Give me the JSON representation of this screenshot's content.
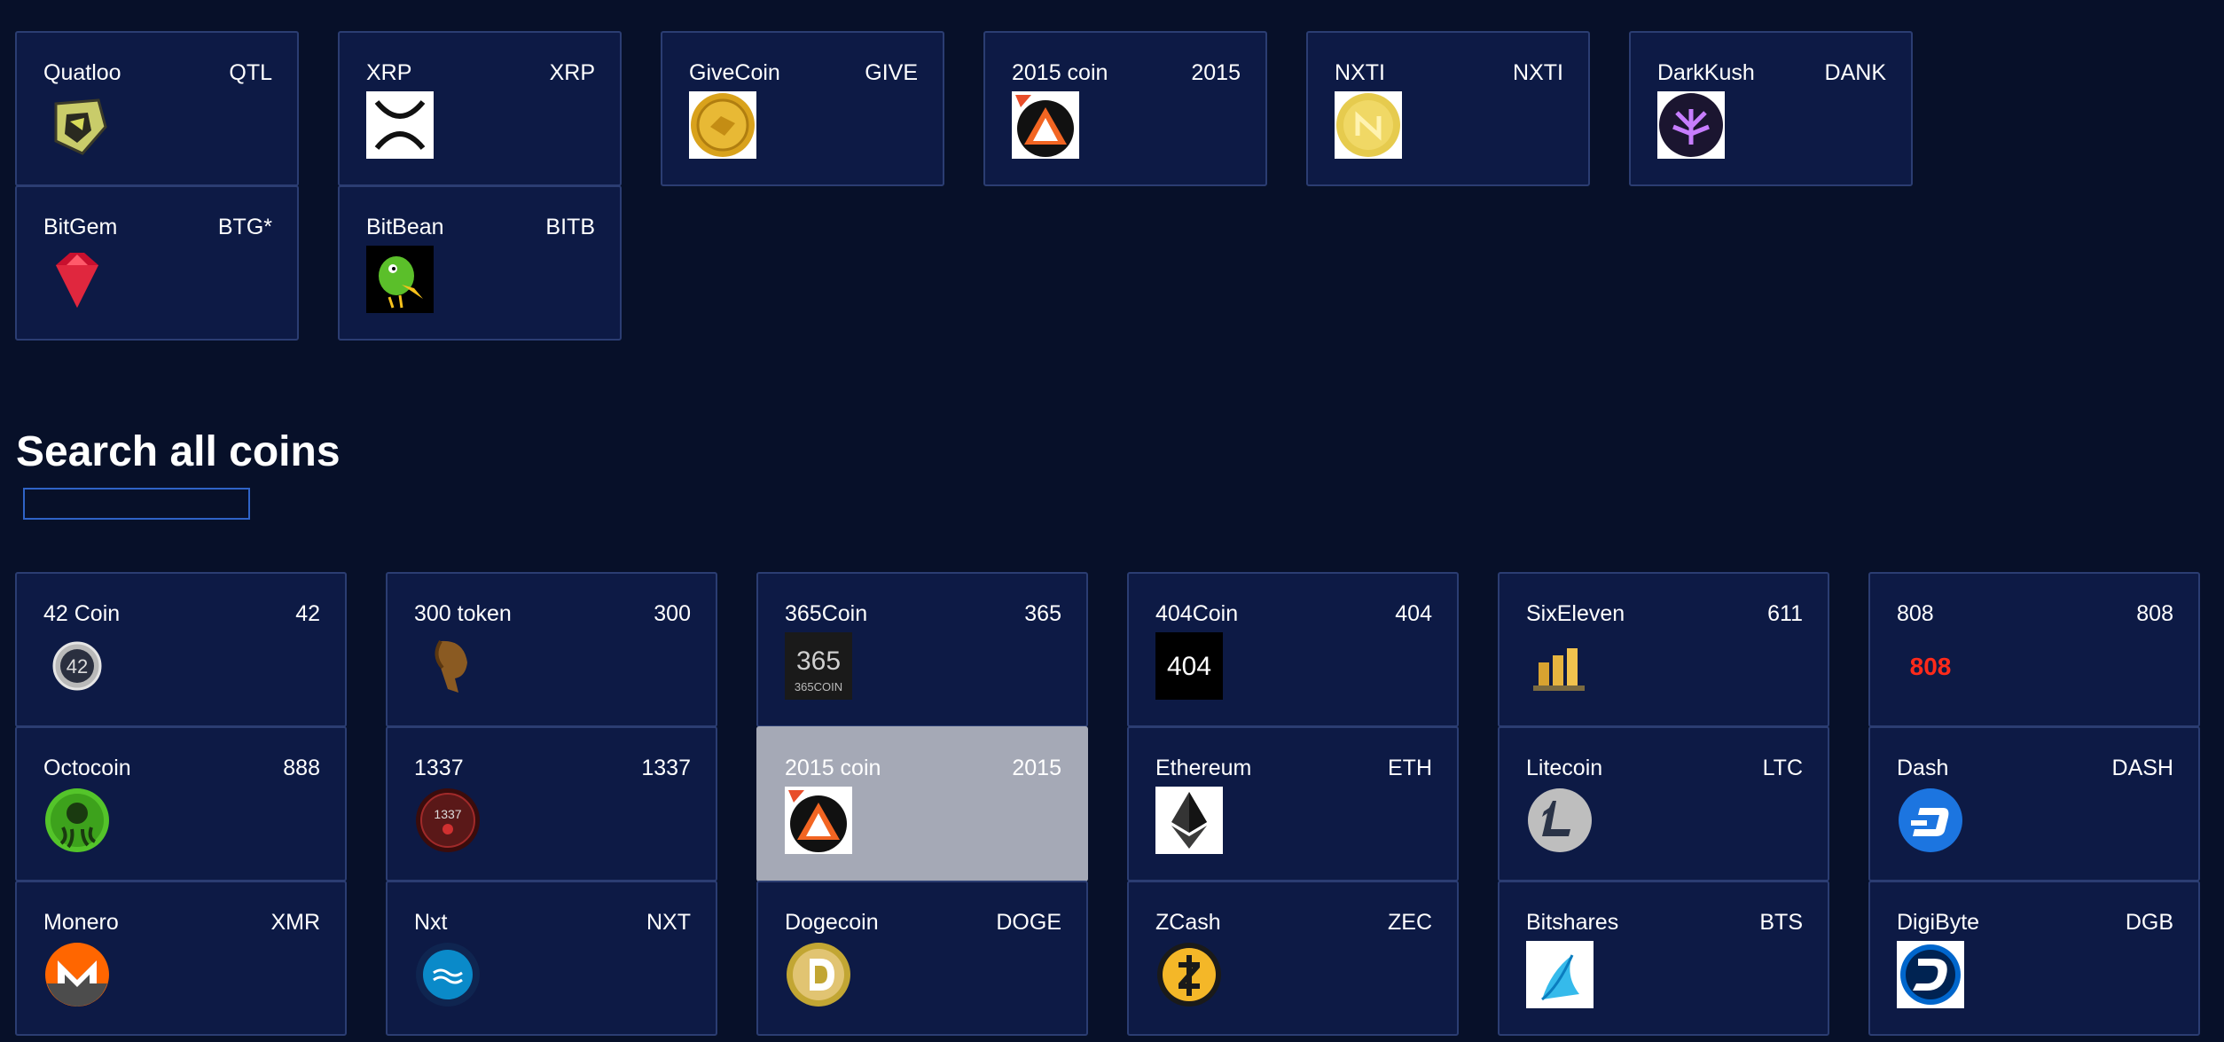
{
  "featured": [
    {
      "name": "Quatloo",
      "symbol": "QTL",
      "icon": "quatloo-icon"
    },
    {
      "name": "XRP",
      "symbol": "XRP",
      "icon": "xrp-icon"
    },
    {
      "name": "GiveCoin",
      "symbol": "GIVE",
      "icon": "givecoin-icon"
    },
    {
      "name": "2015 coin",
      "symbol": "2015",
      "icon": "2015coin-icon"
    },
    {
      "name": "NXTI",
      "symbol": "NXTI",
      "icon": "nxti-icon"
    },
    {
      "name": "DarkKush",
      "symbol": "DANK",
      "icon": "darkkush-icon"
    },
    {
      "name": "BitGem",
      "symbol": "BTG*",
      "icon": "bitgem-icon"
    },
    {
      "name": "BitBean",
      "symbol": "BITB",
      "icon": "bitbean-icon"
    }
  ],
  "search": {
    "title": "Search all coins",
    "value": "",
    "placeholder": ""
  },
  "coins": [
    {
      "name": "42 Coin",
      "symbol": "42",
      "icon": "42coin-icon"
    },
    {
      "name": "300 token",
      "symbol": "300",
      "icon": "300token-icon"
    },
    {
      "name": "365Coin",
      "symbol": "365",
      "icon": "365coin-icon"
    },
    {
      "name": "404Coin",
      "symbol": "404",
      "icon": "404coin-icon"
    },
    {
      "name": "SixEleven",
      "symbol": "611",
      "icon": "sixeleven-icon"
    },
    {
      "name": "808",
      "symbol": "808",
      "icon": "808-icon"
    },
    {
      "name": "Octocoin",
      "symbol": "888",
      "icon": "octocoin-icon"
    },
    {
      "name": "1337",
      "symbol": "1337",
      "icon": "1337-icon"
    },
    {
      "name": "2015 coin",
      "symbol": "2015",
      "icon": "2015coin-icon",
      "selected": true
    },
    {
      "name": "Ethereum",
      "symbol": "ETH",
      "icon": "ethereum-icon"
    },
    {
      "name": "Litecoin",
      "symbol": "LTC",
      "icon": "litecoin-icon"
    },
    {
      "name": "Dash",
      "symbol": "DASH",
      "icon": "dash-icon"
    },
    {
      "name": "Monero",
      "symbol": "XMR",
      "icon": "monero-icon"
    },
    {
      "name": "Nxt",
      "symbol": "NXT",
      "icon": "nxt-icon"
    },
    {
      "name": "Dogecoin",
      "symbol": "DOGE",
      "icon": "dogecoin-icon"
    },
    {
      "name": "ZCash",
      "symbol": "ZEC",
      "icon": "zcash-icon"
    },
    {
      "name": "Bitshares",
      "symbol": "BTS",
      "icon": "bitshares-icon"
    },
    {
      "name": "DigiByte",
      "symbol": "DGB",
      "icon": "digibyte-icon"
    }
  ],
  "colors": {
    "background": "#071029",
    "card": "#0d1a45",
    "card_border": "#2b3d72",
    "card_selected": "#a5a9b6",
    "input_border": "#2f63c7"
  }
}
